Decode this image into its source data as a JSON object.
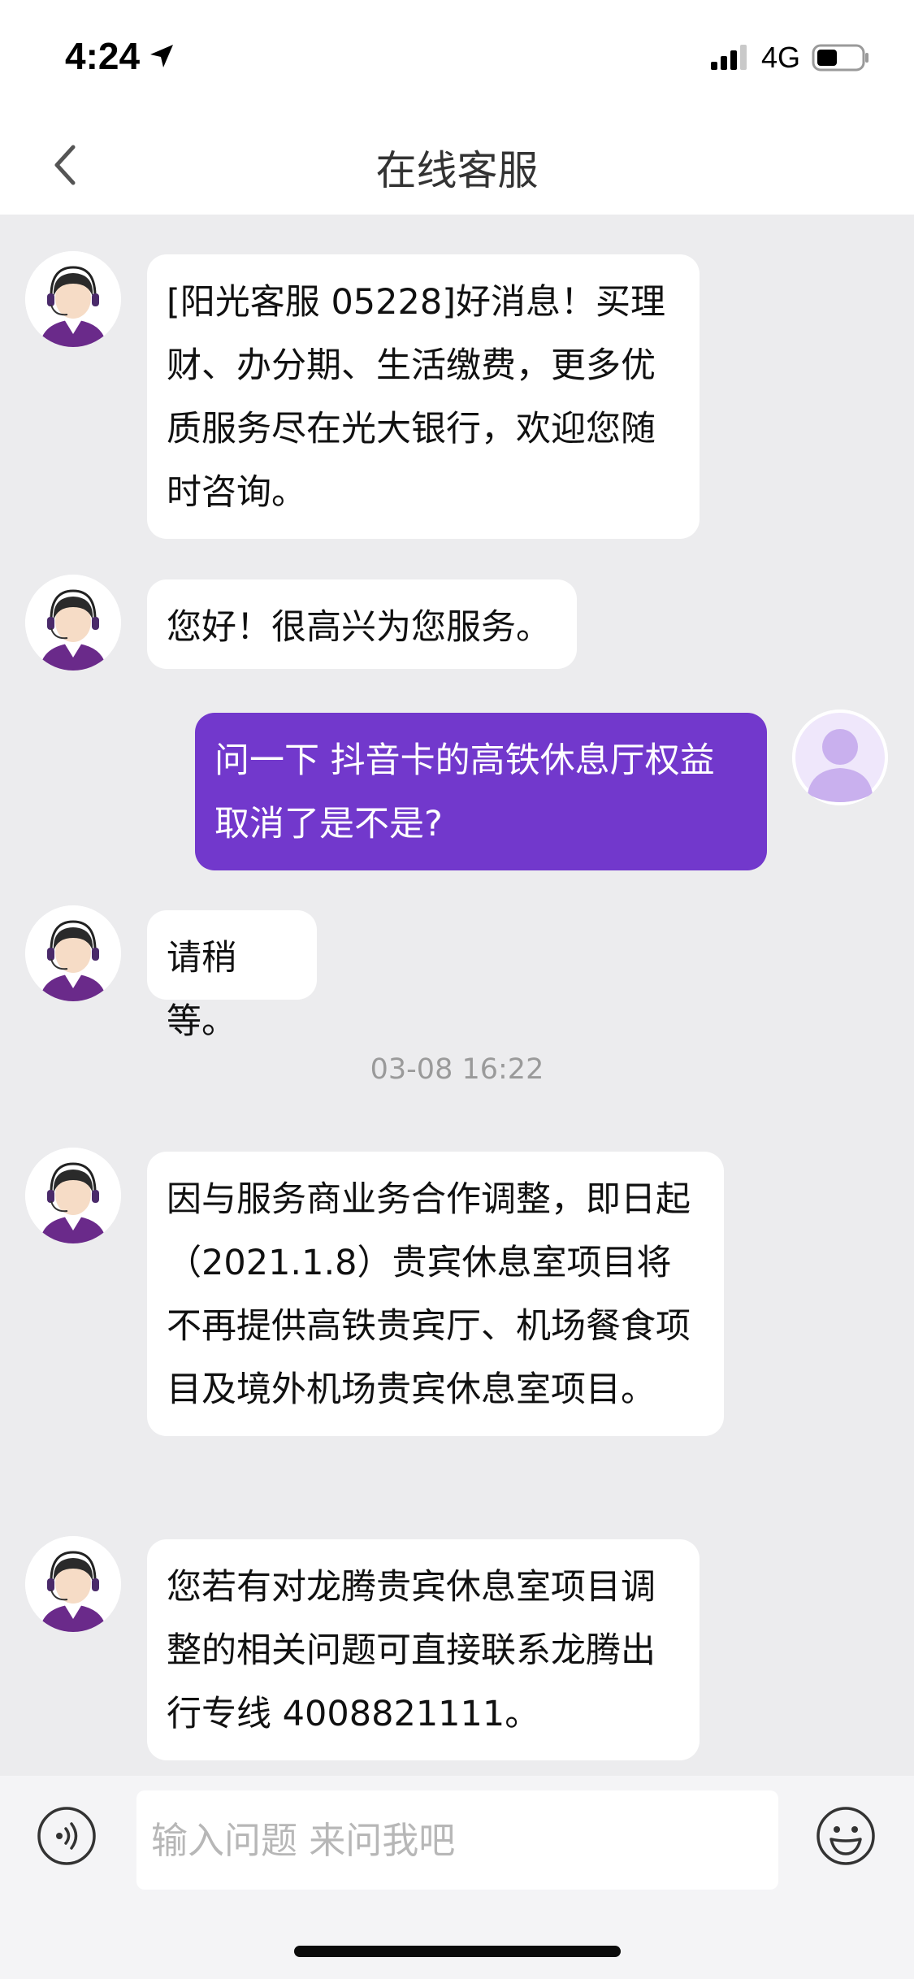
{
  "status_bar": {
    "time": "4:24",
    "network": "4G"
  },
  "nav": {
    "title": "在线客服"
  },
  "messages": [
    {
      "sender": "agent",
      "text": "[阳光客服 05228]好消息！买理财、办分期、生活缴费，更多优质服务尽在光大银行，欢迎您随时咨询。"
    },
    {
      "sender": "agent",
      "text": "您好！很高兴为您服务。"
    },
    {
      "sender": "user",
      "text": "问一下  抖音卡的高铁休息厅权益取消了是不是?"
    },
    {
      "sender": "agent",
      "text": "请稍等。"
    },
    {
      "sender": "agent",
      "text": "因与服务商业务合作调整，即日起（2021.1.8）贵宾休息室项目将不再提供高铁贵宾厅、机场餐食项目及境外机场贵宾休息室项目。"
    },
    {
      "sender": "agent",
      "text": "您若有对龙腾贵宾休息室项目调整的相关问题可直接联系龙腾出行专线 4008821111。"
    }
  ],
  "timestamp": "03-08 16:22",
  "input": {
    "placeholder": "输入问题 来问我吧"
  },
  "colors": {
    "accent": "#7238cc",
    "background": "#ececee"
  },
  "icons": [
    "navigation-arrow-icon",
    "signal-icon",
    "battery-icon",
    "back-chevron-icon",
    "agent-avatar-icon",
    "user-avatar-icon",
    "voice-icon",
    "emoji-icon"
  ]
}
